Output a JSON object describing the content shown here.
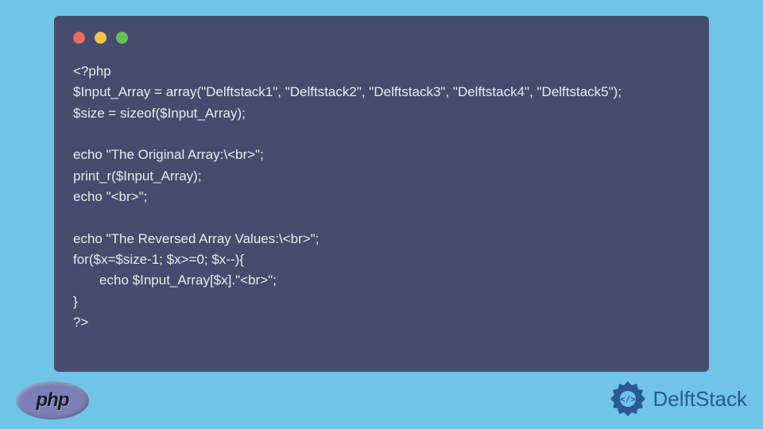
{
  "code": {
    "line1": "<?php",
    "line2": "$Input_Array = array(\"Delftstack1\", \"Delftstack2\", \"Delftstack3\", \"Delftstack4\", \"Delftstack5\");",
    "line3": "$size = sizeof($Input_Array);",
    "line4": "",
    "line5": "echo \"The Original Array:\\<br>\";",
    "line6": "print_r($Input_Array);",
    "line7": "echo \"<br>\";",
    "line8": "",
    "line9": "echo \"The Reversed Array Values:\\<br>\";",
    "line10": "for($x=$size-1; $x>=0; $x--){",
    "line11": "       echo $Input_Array[$x].\"<br>\";",
    "line12": "}",
    "line13": "?>"
  },
  "logos": {
    "php": "php",
    "delftstack": "DelftStack"
  }
}
